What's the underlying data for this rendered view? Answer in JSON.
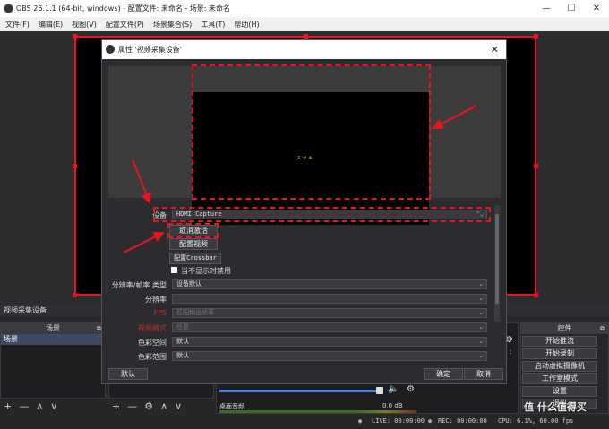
{
  "app": {
    "title": "OBS 26.1.1 (64-bit, windows) - 配置文件: 未命名 - 场景: 未命名",
    "window_controls": [
      "—",
      "☐",
      "✕"
    ]
  },
  "menu": [
    "文件(F)",
    "编辑(E)",
    "视图(V)",
    "配置文件(P)",
    "场景集合(S)",
    "工具(T)",
    "帮助(H)"
  ],
  "source_dock_title": "视频采集设备",
  "scenes": {
    "header": "场景",
    "items": [
      "场景"
    ]
  },
  "sources_header": "",
  "controls": {
    "header": "控件",
    "buttons": [
      "开始推流",
      "开始录制",
      "启动虚拟摄像机",
      "工作室模式",
      "设置",
      "退出"
    ]
  },
  "mixer": {
    "track_name": "桌面音频",
    "level": "0.0 dB"
  },
  "status": {
    "live": "LIVE: 00:00:00",
    "rec": "REC: 00:00:00",
    "cpu": "CPU: 6.1%, 60.00 fps"
  },
  "dialog": {
    "title": "属性 '视频采集设备'",
    "preview_text": "ス セ キ",
    "device_label": "设备",
    "device_value": "HDMI Capture",
    "deactivate_button": "取消激活",
    "config_video_button": "配置视频",
    "config_crossbar_button": "配置Crossbar",
    "deactivate_when_hidden": "当不显示时禁用",
    "res_type_label": "分辨率/帧率 类型",
    "res_type_value": "设备默认",
    "resolution_label": "分辨率",
    "resolution_value": "",
    "fps_label": "FPS",
    "fps_value": "匹配输出帧率",
    "video_format_label": "视频格式",
    "video_format_value": "任意",
    "color_space_label": "色彩空间",
    "color_space_value": "默认",
    "color_range_label": "色彩范围",
    "color_range_value": "默认",
    "defaults_button": "默认",
    "ok_button": "确定",
    "cancel_button": "取消"
  },
  "watermark": "值 什么值得买",
  "colors": {
    "highlight": "#e8141e",
    "bg": "#2c2c30"
  }
}
